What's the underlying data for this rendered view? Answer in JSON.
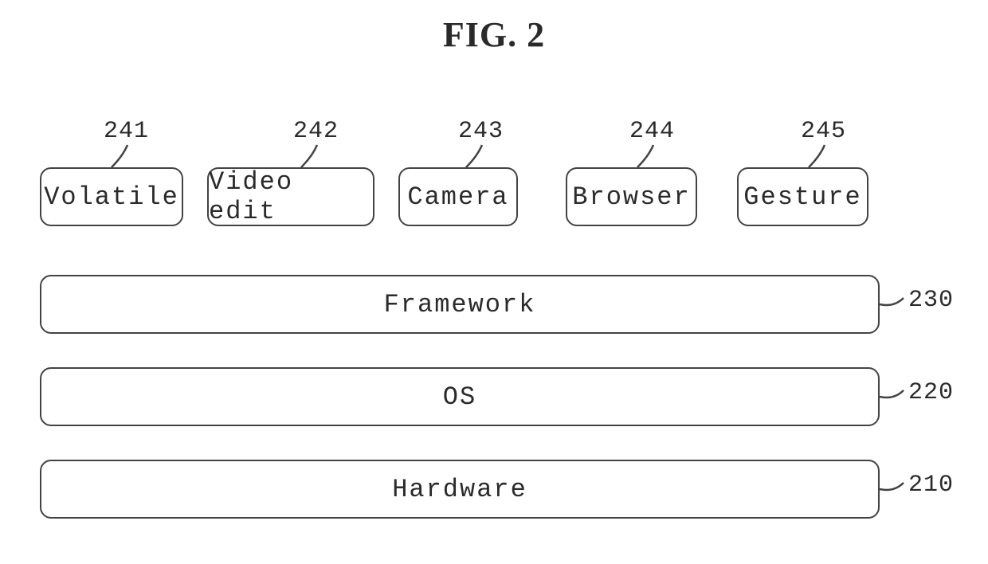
{
  "title": "FIG. 2",
  "modules": [
    {
      "ref": "241",
      "label": "Volatile"
    },
    {
      "ref": "242",
      "label": "Video edit"
    },
    {
      "ref": "243",
      "label": "Camera"
    },
    {
      "ref": "244",
      "label": "Browser"
    },
    {
      "ref": "245",
      "label": "Gesture"
    }
  ],
  "layers": [
    {
      "ref": "230",
      "label": "Framework"
    },
    {
      "ref": "220",
      "label": "OS"
    },
    {
      "ref": "210",
      "label": "Hardware"
    }
  ]
}
